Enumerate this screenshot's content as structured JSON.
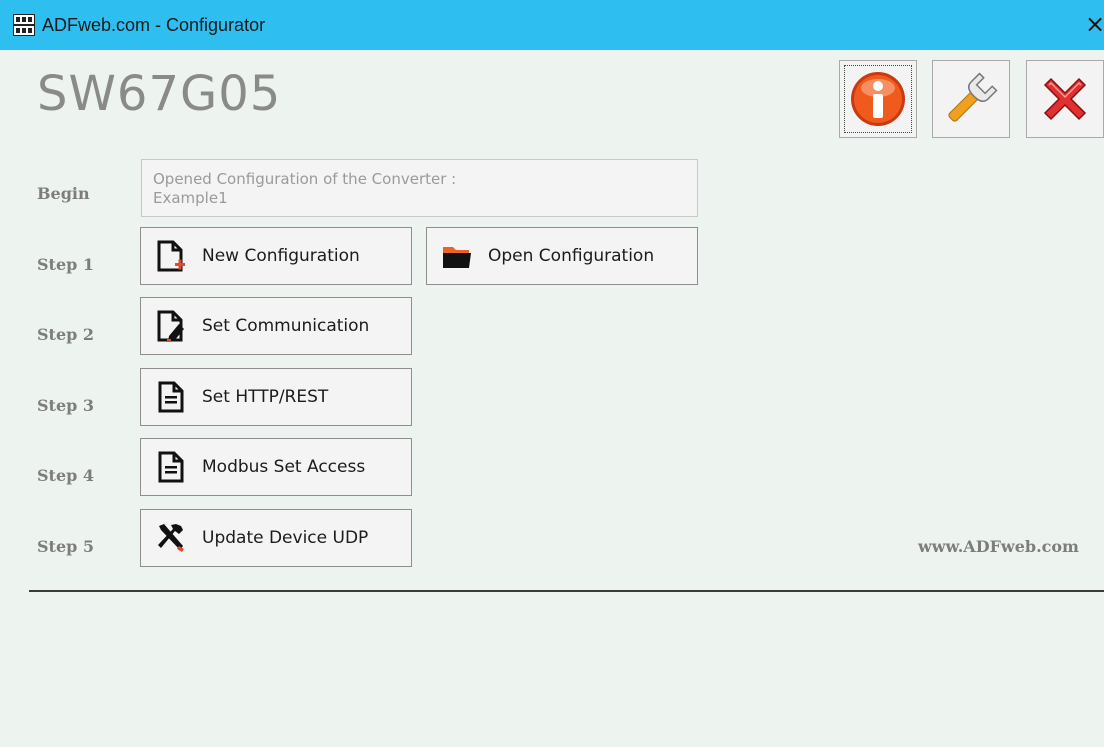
{
  "window": {
    "title": "ADFweb.com - Configurator",
    "close_glyph": "×"
  },
  "header": {
    "product": "SW67G05",
    "toolbar": [
      {
        "name": "info-button",
        "icon": "info-icon"
      },
      {
        "name": "settings-button",
        "icon": "wrench-icon"
      },
      {
        "name": "exit-button",
        "icon": "red-x-icon"
      }
    ]
  },
  "steps": {
    "begin": {
      "label": "Begin",
      "line1": "Opened Configuration of the Converter :",
      "line2": "Example1"
    },
    "step1": {
      "label": "Step 1",
      "new_config": "New Configuration",
      "open_config": "Open Configuration"
    },
    "step2": {
      "label": "Step 2",
      "button": "Set Communication"
    },
    "step3": {
      "label": "Step 3",
      "button": "Set HTTP/REST"
    },
    "step4": {
      "label": "Step 4",
      "button": "Modbus Set Access"
    },
    "step5": {
      "label": "Step 5",
      "button": "Update Device UDP"
    }
  },
  "footer": {
    "website": "www.ADFweb.com"
  },
  "colors": {
    "titlebar": "#2fbef0",
    "background": "#edf4f0",
    "label_gray": "#7d7d7d"
  }
}
